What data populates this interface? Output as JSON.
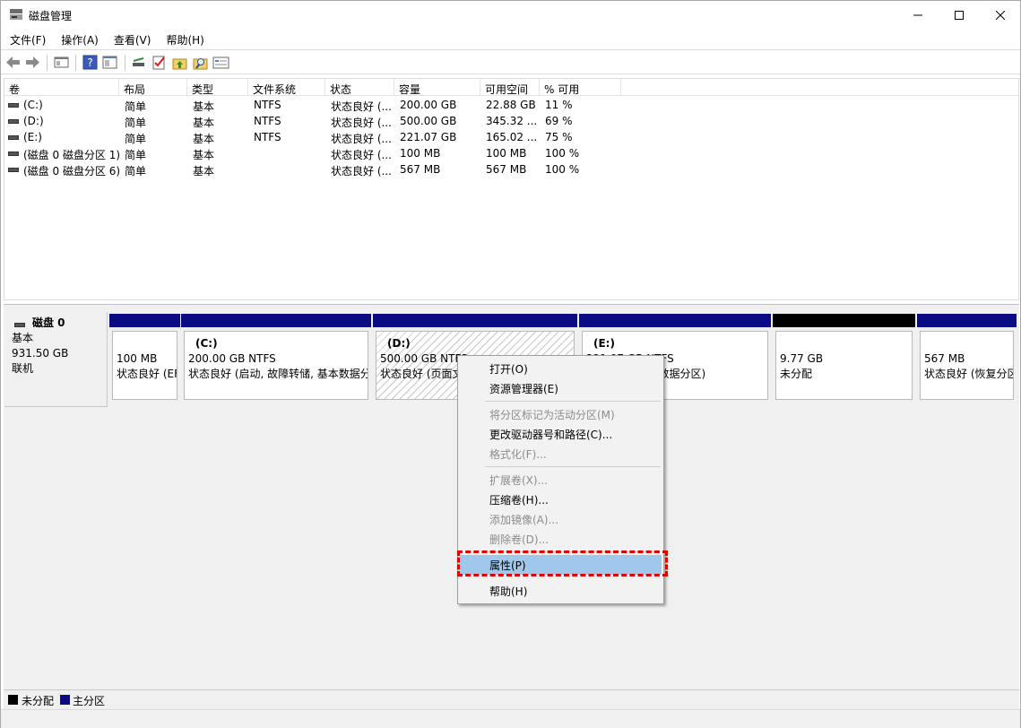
{
  "window": {
    "title": "磁盘管理"
  },
  "menu": [
    "文件(F)",
    "操作(A)",
    "查看(V)",
    "帮助(H)"
  ],
  "columns": [
    "卷",
    "布局",
    "类型",
    "文件系统",
    "状态",
    "容量",
    "可用空间",
    "% 可用"
  ],
  "volumes": [
    {
      "name": "(C:)",
      "layout": "简单",
      "type": "基本",
      "fs": "NTFS",
      "status": "状态良好 (...",
      "capacity": "200.00 GB",
      "free": "22.88 GB",
      "pct": "11 %"
    },
    {
      "name": "(D:)",
      "layout": "简单",
      "type": "基本",
      "fs": "NTFS",
      "status": "状态良好 (...",
      "capacity": "500.00 GB",
      "free": "345.32 ...",
      "pct": "69 %"
    },
    {
      "name": "(E:)",
      "layout": "简单",
      "type": "基本",
      "fs": "NTFS",
      "status": "状态良好 (...",
      "capacity": "221.07 GB",
      "free": "165.02 ...",
      "pct": "75 %"
    },
    {
      "name": "(磁盘 0 磁盘分区 1)",
      "layout": "简单",
      "type": "基本",
      "fs": "",
      "status": "状态良好 (...",
      "capacity": "100 MB",
      "free": "100 MB",
      "pct": "100 %"
    },
    {
      "name": "(磁盘 0 磁盘分区 6)",
      "layout": "简单",
      "type": "基本",
      "fs": "",
      "status": "状态良好 (...",
      "capacity": "567 MB",
      "free": "567 MB",
      "pct": "100 %"
    }
  ],
  "disk": {
    "name": "磁盘 0",
    "type": "基本",
    "size": "931.50 GB",
    "state": "联机"
  },
  "partitions": [
    {
      "title": "",
      "line1": "100 MB",
      "line2": "状态良好 (EFI 系统分区)"
    },
    {
      "title": "(C:)",
      "line1": "200.00 GB NTFS",
      "line2": "状态良好 (启动, 故障转储, 基本数据分区)"
    },
    {
      "title": "(D:)",
      "line1": "500.00 GB NTFS",
      "line2": "状态良好 (页面文件, 基本数据分区)"
    },
    {
      "title": "(E:)",
      "line1": "221.07 GB NTFS",
      "line2": "状态良好 (基本数据分区)"
    },
    {
      "title": "",
      "line1": "9.77 GB",
      "line2": "未分配"
    },
    {
      "title": "",
      "line1": "567 MB",
      "line2": "状态良好 (恢复分区)"
    }
  ],
  "context_menu": {
    "open": "打开(O)",
    "explorer": "资源管理器(E)",
    "mark_active": "将分区标记为活动分区(M)",
    "change_letter": "更改驱动器号和路径(C)...",
    "format": "格式化(F)...",
    "extend": "扩展卷(X)...",
    "shrink": "压缩卷(H)...",
    "add_mirror": "添加镜像(A)...",
    "delete": "删除卷(D)...",
    "properties": "属性(P)",
    "help": "帮助(H)"
  },
  "legend": {
    "unallocated": "未分配",
    "primary": "主分区"
  },
  "colors": {
    "primary_partition": "#0b0b86",
    "unallocated": "#000000",
    "menu_highlight": "#9fc8ec",
    "annotation": "#e00000"
  }
}
